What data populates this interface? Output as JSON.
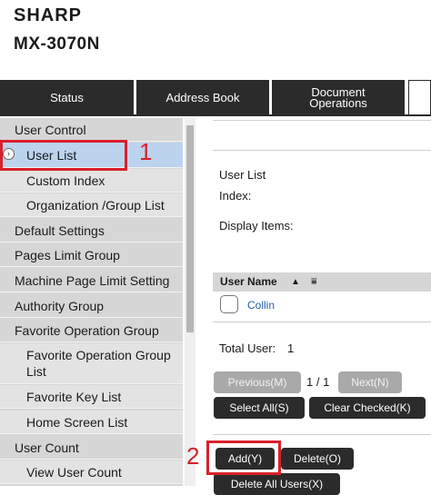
{
  "header": {
    "brand": "SHARP",
    "model": "MX-3070N"
  },
  "tabs": [
    {
      "label": "Status"
    },
    {
      "label": "Address Book"
    },
    {
      "label": "Document\nOperations"
    }
  ],
  "sidebar": {
    "items": [
      {
        "label": "User Control"
      },
      {
        "label": "User List"
      },
      {
        "label": "Custom Index"
      },
      {
        "label": "Organization /Group List"
      },
      {
        "label": "Default Settings"
      },
      {
        "label": "Pages Limit Group"
      },
      {
        "label": "Machine Page Limit Setting"
      },
      {
        "label": "Authority Group"
      },
      {
        "label": "Favorite Operation Group"
      },
      {
        "label": "Favorite Operation Group List"
      },
      {
        "label": "Favorite Key List"
      },
      {
        "label": "Home Screen List"
      },
      {
        "label": "User Count"
      },
      {
        "label": "View User Count"
      }
    ]
  },
  "main": {
    "section_title": "User List",
    "index_label": "Index:",
    "display_items_label": "Display Items:",
    "table": {
      "col_user_name": "User Name",
      "sort_icon": "▲",
      "filter_icon": "⩸",
      "rows": [
        {
          "name": "Collin"
        }
      ]
    },
    "total_label": "Total User:",
    "total_value": "1",
    "pager": {
      "prev": "Previous(M)",
      "page": "1 / 1",
      "next": "Next(N)"
    },
    "buttons": {
      "select_all": "Select All(S)",
      "clear_checked": "Clear Checked(K)",
      "add": "Add(Y)",
      "delete": "Delete(O)",
      "delete_all": "Delete All Users(X)"
    }
  },
  "annotations": {
    "step1": "1",
    "step2": "2",
    "color": "#d8202b"
  }
}
